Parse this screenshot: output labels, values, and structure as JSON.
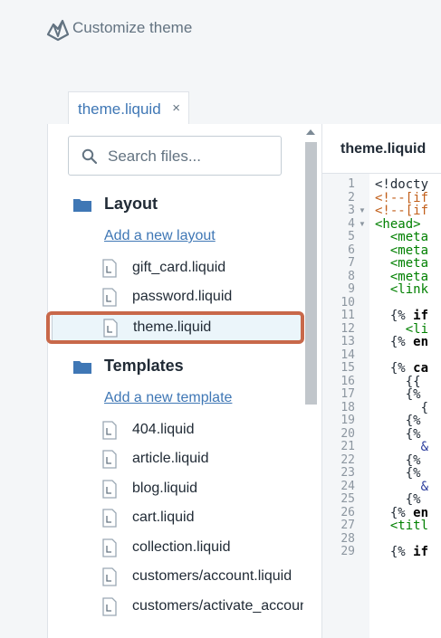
{
  "header": {
    "title": "Customize theme"
  },
  "tab": {
    "label": "theme.liquid",
    "close_glyph": "×"
  },
  "search": {
    "placeholder": "Search files..."
  },
  "sections": [
    {
      "title": "Layout",
      "add_link": "Add a new layout",
      "files": [
        "gift_card.liquid",
        "password.liquid",
        "theme.liquid"
      ]
    },
    {
      "title": "Templates",
      "add_link": "Add a new template",
      "files": [
        "404.liquid",
        "article.liquid",
        "blog.liquid",
        "cart.liquid",
        "collection.liquid",
        "customers/account.liquid",
        "customers/activate_accoun"
      ]
    }
  ],
  "editor": {
    "title": "theme.liquid",
    "line_numbers": [
      "1",
      "2",
      "3",
      "4",
      "5",
      "6",
      "7",
      "8",
      "9",
      "10",
      "11",
      "12",
      "13",
      "14",
      "15",
      "16",
      "17",
      "18",
      "19",
      "20",
      "21",
      "22",
      "23",
      "24",
      "25",
      "26",
      "27",
      "28",
      "29"
    ],
    "code": [
      {
        "segments": [
          {
            "cls": "c-plain",
            "text": "<!docty"
          }
        ]
      },
      {
        "segments": [
          {
            "cls": "c-comment",
            "text": "<!--[if"
          }
        ]
      },
      {
        "segments": [
          {
            "cls": "c-comment",
            "text": "<!--[if"
          }
        ]
      },
      {
        "segments": [
          {
            "cls": "c-tag",
            "text": "<head>"
          }
        ]
      },
      {
        "segments": [
          {
            "cls": "c-tag",
            "text": "  <meta"
          }
        ]
      },
      {
        "segments": [
          {
            "cls": "c-tag",
            "text": "  <meta"
          }
        ]
      },
      {
        "segments": [
          {
            "cls": "c-tag",
            "text": "  <meta"
          }
        ]
      },
      {
        "segments": [
          {
            "cls": "c-tag",
            "text": "  <meta"
          }
        ]
      },
      {
        "segments": [
          {
            "cls": "c-tag",
            "text": "  <link"
          }
        ]
      },
      {
        "segments": []
      },
      {
        "segments": [
          {
            "cls": "c-liquid",
            "text": "  {% "
          },
          {
            "cls": "c-kw",
            "text": "if"
          }
        ]
      },
      {
        "segments": [
          {
            "cls": "c-tag",
            "text": "    <li"
          }
        ]
      },
      {
        "segments": [
          {
            "cls": "c-liquid",
            "text": "  {% "
          },
          {
            "cls": "c-kw",
            "text": "en"
          }
        ]
      },
      {
        "segments": []
      },
      {
        "segments": [
          {
            "cls": "c-liquid",
            "text": "  {% "
          },
          {
            "cls": "c-kw",
            "text": "ca"
          }
        ]
      },
      {
        "segments": [
          {
            "cls": "c-liquid",
            "text": "    {{"
          }
        ]
      },
      {
        "segments": [
          {
            "cls": "c-liquid",
            "text": "    {%"
          }
        ]
      },
      {
        "segments": [
          {
            "cls": "c-liquid",
            "text": "      {"
          }
        ]
      },
      {
        "segments": [
          {
            "cls": "c-liquid",
            "text": "    {%"
          }
        ]
      },
      {
        "segments": [
          {
            "cls": "c-liquid",
            "text": "    {%"
          }
        ]
      },
      {
        "segments": [
          {
            "cls": "c-amp",
            "text": "      &"
          }
        ]
      },
      {
        "segments": [
          {
            "cls": "c-liquid",
            "text": "    {%"
          }
        ]
      },
      {
        "segments": [
          {
            "cls": "c-liquid",
            "text": "    {%"
          }
        ]
      },
      {
        "segments": [
          {
            "cls": "c-amp",
            "text": "      &"
          }
        ]
      },
      {
        "segments": [
          {
            "cls": "c-liquid",
            "text": "    {%"
          }
        ]
      },
      {
        "segments": [
          {
            "cls": "c-liquid",
            "text": "  {% "
          },
          {
            "cls": "c-kw",
            "text": "en"
          }
        ]
      },
      {
        "segments": [
          {
            "cls": "c-tag",
            "text": "  <titl"
          }
        ]
      },
      {
        "segments": []
      },
      {
        "segments": [
          {
            "cls": "c-liquid",
            "text": "  {% "
          },
          {
            "cls": "c-kw",
            "text": "if"
          }
        ]
      }
    ],
    "folded_lines": [
      3,
      4
    ]
  },
  "colors": {
    "link": "#3f77b5",
    "highlight_border": "#c8684a",
    "tag": "#008000",
    "comment": "#c25f1a"
  },
  "icons": {
    "logo": "theme-editor-logo-icon",
    "search": "search-icon",
    "folder": "folder-icon",
    "file": "file-icon"
  }
}
